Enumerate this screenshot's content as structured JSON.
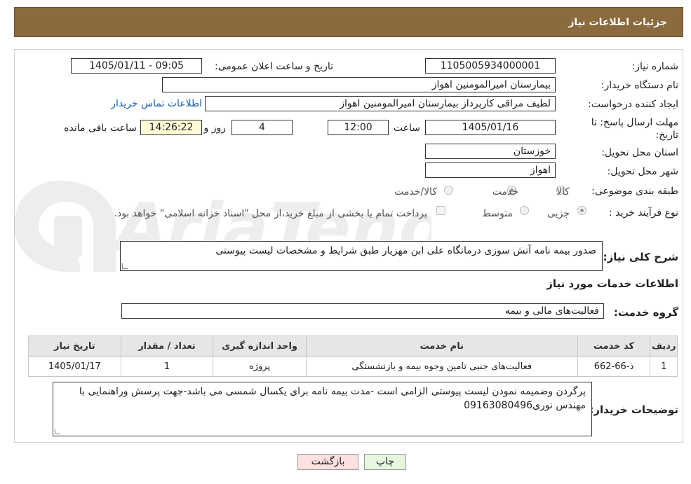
{
  "header": {
    "title": "جزئیات اطلاعات نیاز"
  },
  "form": {
    "need_number": {
      "label": "شماره نیاز:",
      "value": "1105005934000001"
    },
    "announce_datetime": {
      "label": "تاریخ و ساعت اعلان عمومی:",
      "value": "1405/01/11 - 09:05"
    },
    "buyer_org": {
      "label": "نام دستگاه خریدار:",
      "value": "بیمارستان امیرالمومنین اهواز"
    },
    "requester": {
      "label": "ایجاد کننده درخواست:",
      "value": "لطیف مراقی کارپرداز بیمارستان امیرالمومنین اهواز",
      "contact_link": "اطلاعات تماس خریدار"
    },
    "deadline": {
      "label": "مهلت ارسال پاسخ: تا تاریخ:",
      "date": "1405/01/16",
      "time_label": "ساعت",
      "time": "12:00",
      "days": "4",
      "days_label": "روز و",
      "remaining_time": "14:26:22",
      "remaining_label": "ساعت باقی مانده"
    },
    "province": {
      "label": "استان محل تحویل:",
      "value": "خوزستان"
    },
    "city": {
      "label": "شهر محل تحویل:",
      "value": "اهواز"
    },
    "category": {
      "label": "طبقه بندی موضوعی:",
      "options": [
        "کالا",
        "خدمت",
        "کالا/خدمت"
      ],
      "selected": "خدمت"
    },
    "purchase_process": {
      "label": "نوع فرآیند خرید :",
      "options": [
        "جزیی",
        "متوسط"
      ],
      "selected": "جزیی",
      "note": "پرداخت تمام یا بخشی از مبلغ خرید،از محل \"اسناد خزانه اسلامی\" خواهد بود."
    },
    "description": {
      "label": "شرح کلی نیاز:",
      "value": "صدور بیمه نامه آتش سوزی درمانگاه علی ابن مهزیار طبق شرایط و مشخصات لیست پیوستی"
    },
    "services_section_title": "اطلاعات خدمات مورد نیاز",
    "service_group": {
      "label": "گروه خدمت:",
      "value": "فعالیت‌های مالی و بیمه"
    }
  },
  "table": {
    "headers": [
      "ردیف",
      "کد خدمت",
      "نام خدمت",
      "واحد اندازه گیری",
      "تعداد / مقدار",
      "تاریخ نیاز"
    ],
    "rows": [
      [
        "1",
        "ذ-66-662",
        "فعالیت‌های جنبی تامین وجوه بیمه و بازنشستگی",
        "پروژه",
        "1",
        "1405/01/17"
      ]
    ]
  },
  "buyer_notes": {
    "label": "توضیحات خریدار:",
    "value": "پرگردن وضمیمه نمودن لیست پیوستی الزامی است -مدت بیمه نامه برای یکسال شمسی می باشد-جهت پرسش وراهنمایی با مهندس نوری09163080496"
  },
  "buttons": {
    "print": "چاپ",
    "back": "بازگشت"
  },
  "colors": {
    "header_bg": "#8b6a3e",
    "back_button_bg": "#ffe0e0",
    "print_button_bg": "#e6f7e0",
    "remaining_bg": "#fffbd6"
  }
}
